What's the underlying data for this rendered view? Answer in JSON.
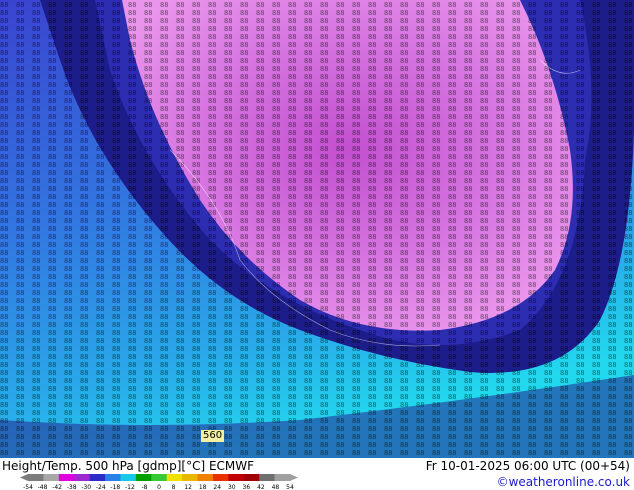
{
  "map": {
    "contour_label": "560",
    "colors": {
      "deep_blue": "#1c1c8a",
      "blue": "#3f4fd8",
      "light_blue": "#2b8fe6",
      "cyan": "#28d3e8",
      "pink": "#e58ae8",
      "magenta": "#c85ad6"
    }
  },
  "footer": {
    "title_left": "Height/Temp. 500 hPa [gdmp][°C] ECMWF",
    "title_right": "Fr 10-01-2025 06:00 UTC (00+54)",
    "credit": "©weatheronline.co.uk",
    "scale": {
      "ticks": [
        "-54",
        "-48",
        "-42",
        "-38",
        "-30",
        "-24",
        "-18",
        "-12",
        "-8",
        "0",
        "8",
        "12",
        "18",
        "24",
        "30",
        "36",
        "42",
        "48",
        "54"
      ],
      "colors": [
        "#7c7c7c",
        "#a8a8a8",
        "#e000e0",
        "#9c2ad0",
        "#2c2cc8",
        "#2880e8",
        "#18c8e8",
        "#00a000",
        "#38c838",
        "#f0e000",
        "#e8b800",
        "#f08000",
        "#e83000",
        "#c00000",
        "#a00000",
        "#707070",
        "#a0a0a0"
      ]
    }
  }
}
